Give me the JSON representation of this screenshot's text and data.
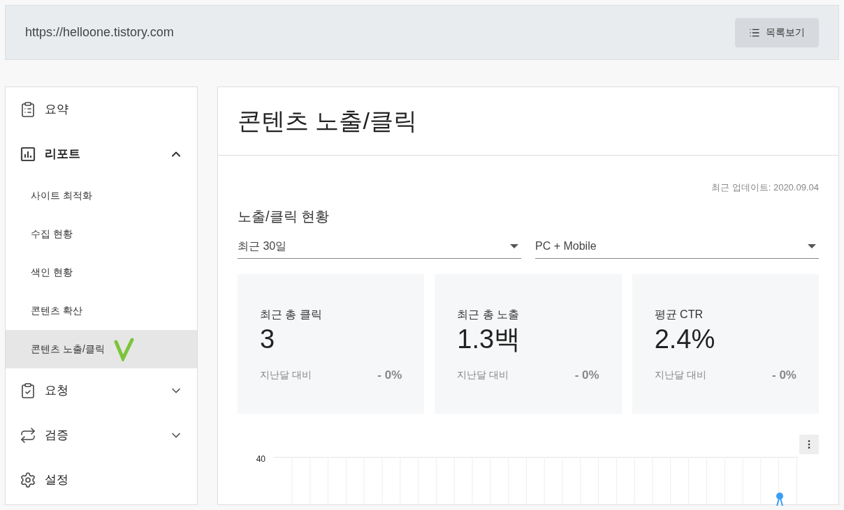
{
  "header": {
    "url": "https://helloone.tistory.com",
    "list_button": "목록보기"
  },
  "sidebar": {
    "items": [
      {
        "kind": "top",
        "label": "요약"
      },
      {
        "kind": "top",
        "label": "리포트",
        "expanded": true,
        "children": [
          {
            "label": "사이트 최적화",
            "selected": false
          },
          {
            "label": "수집 현황",
            "selected": false
          },
          {
            "label": "색인 현황",
            "selected": false
          },
          {
            "label": "콘텐츠 확산",
            "selected": false
          },
          {
            "label": "콘텐츠 노출/클릭",
            "selected": true
          }
        ]
      },
      {
        "kind": "top",
        "label": "요청",
        "expanded": false
      },
      {
        "kind": "top",
        "label": "검증",
        "expanded": false
      },
      {
        "kind": "top",
        "label": "설정"
      }
    ]
  },
  "main": {
    "title": "콘텐츠 노출/클릭",
    "updated": "최근 업데이트: 2020.09.04",
    "section_title": "노출/클릭 현황",
    "filters": [
      {
        "value": "최근 30일"
      },
      {
        "value": "PC + Mobile"
      }
    ],
    "stats": [
      {
        "label": "최근 총 클릭",
        "value": "3",
        "compare_label": "지난달 대비",
        "change": "- 0%"
      },
      {
        "label": "최근 총 노출",
        "value": "1.3백",
        "compare_label": "지난달 대비",
        "change": "- 0%"
      },
      {
        "label": "평균 CTR",
        "value": "2.4%",
        "compare_label": "지난달 대비",
        "change": "- 0%"
      }
    ],
    "chart": {
      "y_tick_label": "40"
    }
  }
}
